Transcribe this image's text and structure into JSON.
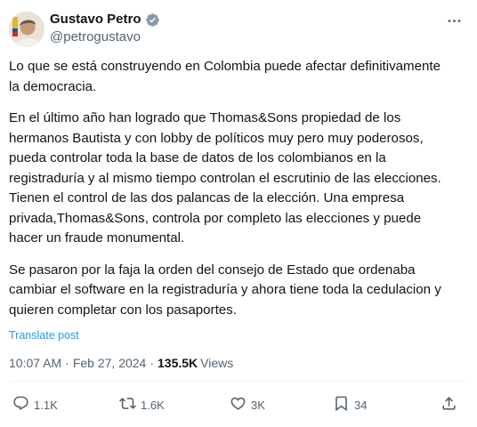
{
  "author": {
    "display_name": "Gustavo Petro",
    "handle": "@petrogustavo",
    "verified_icon": "verified-badge-icon",
    "avatar_icon": "avatar"
  },
  "post": {
    "paragraphs": [
      {
        "lines": [
          "Lo que se está construyendo en Colombia puede afectar definitivamente",
          "la democracia."
        ]
      },
      {
        "lines": [
          "En el último año han logrado que Thomas&Sons propiedad de los",
          "hermanos Bautista y con lobby de políticos muy pero muy poderosos,",
          "pueda controlar toda la base de datos de los colombianos en la",
          "registraduría y al mismo tiempo controlan el escrutinio de las elecciones.",
          "Tienen el control de las dos palancas de la elección. Una empresa",
          "privada,Thomas&Sons, controla por completo las elecciones y puede",
          "hacer un fraude monumental."
        ]
      },
      {
        "lines": [
          "Se pasaron por la faja la orden del consejo de Estado que ordenaba",
          "cambiar el software en la registraduría y ahora tiene toda la cedulacion y",
          "quieren completar con los pasaportes."
        ]
      }
    ],
    "translate_label": "Translate post"
  },
  "meta": {
    "time": "10:07 AM",
    "separator": "·",
    "date": "Feb 27, 2024",
    "views_count": "135.5K",
    "views_label": "Views"
  },
  "actions": {
    "replies": "1.1K",
    "reposts": "1.6K",
    "likes": "3K",
    "bookmarks": "34"
  },
  "colors": {
    "text": "#0f1419",
    "secondary": "#536471",
    "link": "#1d9bf0",
    "verified": "#829aab"
  }
}
